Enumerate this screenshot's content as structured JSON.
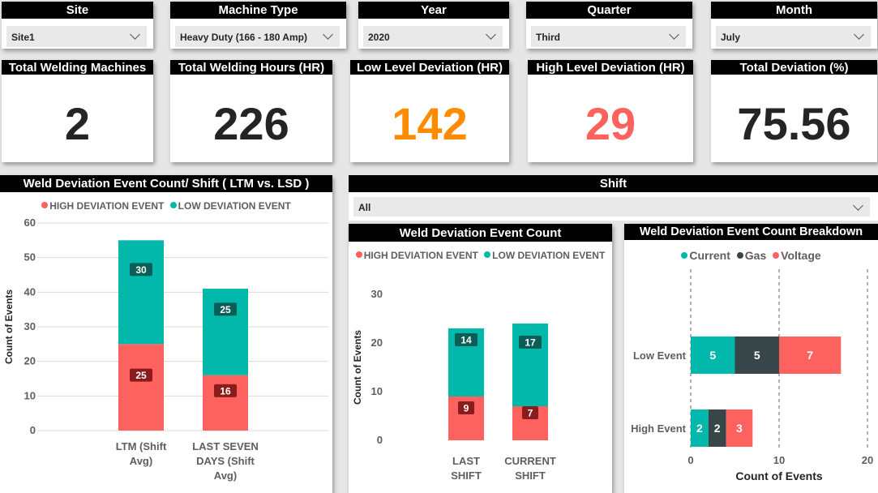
{
  "colors": {
    "high": "#fd625e",
    "low": "#01b8aa",
    "gas": "#374649",
    "orange": "#ff8c00",
    "red_kpi": "#fd625e",
    "dark_kpi": "#252423"
  },
  "filters": [
    {
      "title": "Site",
      "value": "Site1",
      "icon": "chevron-down-icon"
    },
    {
      "title": "Machine Type",
      "value": "Heavy Duty (166 - 180 Amp)",
      "icon": "chevron-down-icon"
    },
    {
      "title": "Year",
      "value": "2020",
      "icon": "chevron-down-icon"
    },
    {
      "title": "Quarter",
      "value": "Third",
      "icon": "chevron-down-icon"
    },
    {
      "title": "Month",
      "value": "July",
      "icon": "chevron-down-icon"
    }
  ],
  "kpis": [
    {
      "title": "Total Welding Machines",
      "value": "2"
    },
    {
      "title": "Total Welding Hours (HR)",
      "value": "226"
    },
    {
      "title": "Low Level Deviation (HR)",
      "value": "142"
    },
    {
      "title": "High Level Deviation (HR)",
      "value": "29"
    },
    {
      "title": "Total Deviation (%)",
      "value": "75.56"
    }
  ],
  "shift_filter": {
    "title": "Shift",
    "value": "All"
  },
  "legend": {
    "high": "HIGH DEVIATION EVENT",
    "low": "LOW DEVIATION EVENT",
    "current": "Current",
    "gas": "Gas",
    "voltage": "Voltage"
  },
  "chart_data": [
    {
      "type": "bar",
      "stacked": true,
      "title": "Weld Deviation Event Count/ Shift ( LTM vs. LSD )",
      "categories": [
        [
          "LTM (Shift",
          "Avg)"
        ],
        [
          "LAST SEVEN",
          "DAYS (Shift",
          "Avg)"
        ]
      ],
      "series": [
        {
          "name": "HIGH DEVIATION EVENT",
          "values": [
            25,
            16
          ]
        },
        {
          "name": "LOW DEVIATION EVENT",
          "values": [
            30,
            25
          ]
        }
      ],
      "ylabel": "Count of Events",
      "ylim": [
        0,
        60
      ],
      "yticks": [
        0,
        10,
        20,
        30,
        40,
        50,
        60
      ],
      "grid": true,
      "legend_position": "top"
    },
    {
      "type": "bar",
      "stacked": true,
      "title": "Weld Deviation Event Count",
      "categories": [
        [
          "LAST",
          "SHIFT"
        ],
        [
          "CURRENT",
          "SHIFT"
        ]
      ],
      "series": [
        {
          "name": "HIGH DEVIATION EVENT",
          "values": [
            9,
            7
          ]
        },
        {
          "name": "LOW DEVIATION EVENT",
          "values": [
            14,
            17
          ]
        }
      ],
      "ylabel": "Count of Events",
      "ylim": [
        0,
        30
      ],
      "yticks": [
        0,
        10,
        20,
        30
      ],
      "grid": false,
      "legend_position": "top"
    },
    {
      "type": "bar",
      "orientation": "horizontal",
      "stacked": true,
      "title": "Weld Deviation Event Count Breakdown",
      "categories": [
        "Low Event",
        "High Event"
      ],
      "series": [
        {
          "name": "Current",
          "values": [
            5,
            2
          ]
        },
        {
          "name": "Gas",
          "values": [
            5,
            2
          ]
        },
        {
          "name": "Voltage",
          "values": [
            7,
            3
          ]
        }
      ],
      "xlabel": "Count of Events",
      "xlim": [
        0,
        20
      ],
      "xticks": [
        0,
        10,
        20
      ],
      "grid": true,
      "legend_position": "top"
    }
  ]
}
